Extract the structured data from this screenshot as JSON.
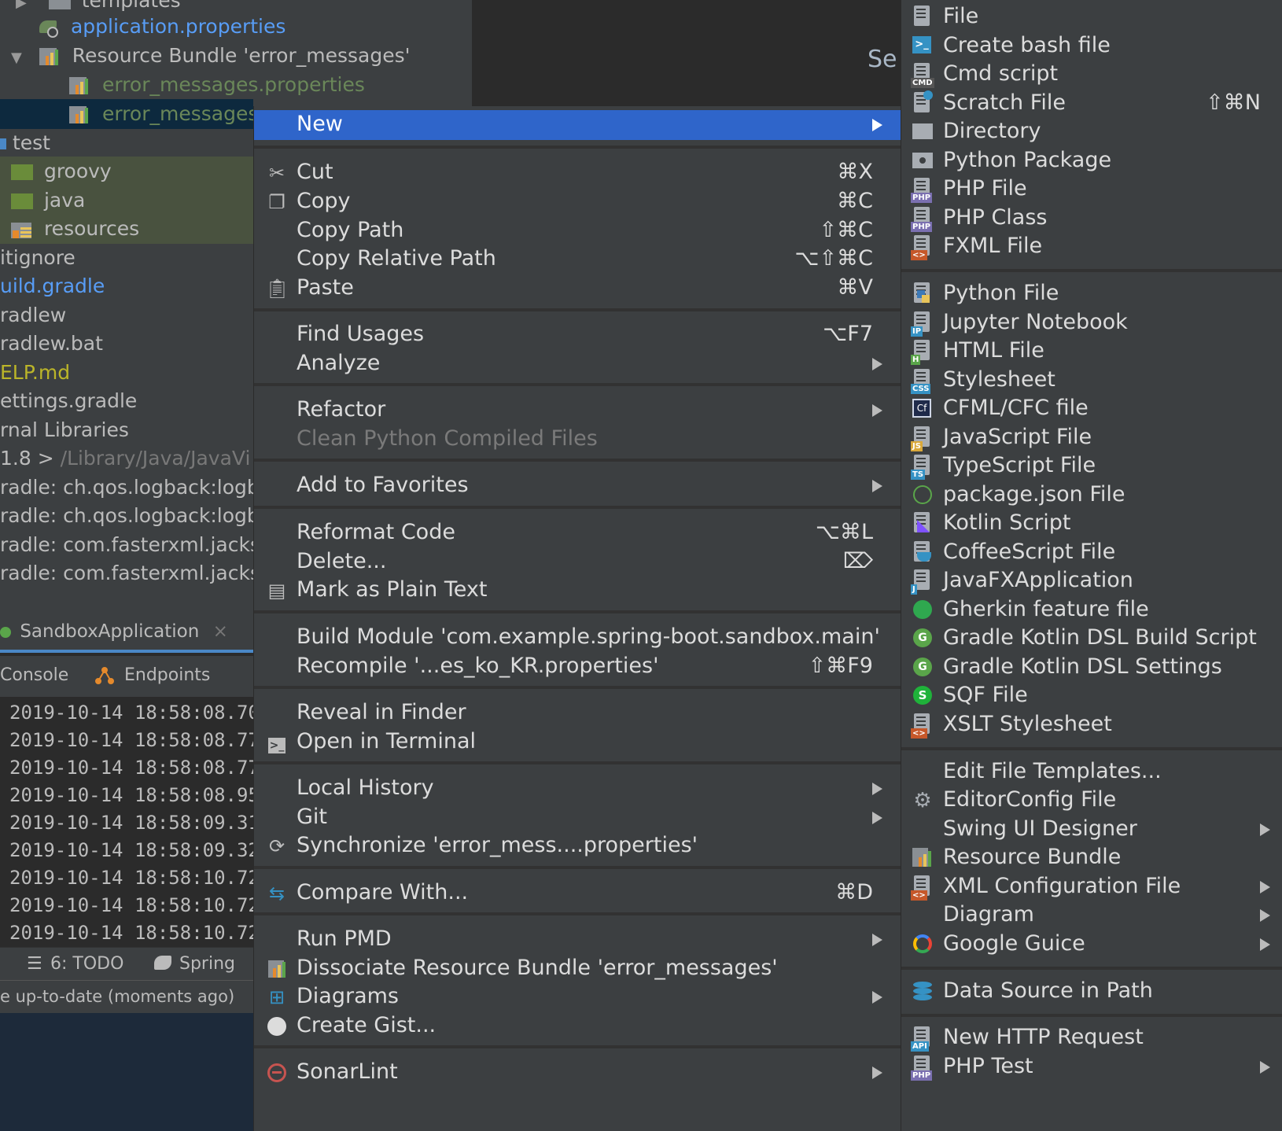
{
  "colors": {
    "menu_bg": "#3c3f41",
    "highlight": "#2f65ca",
    "green_path": "#6a8759",
    "link_blue": "#589df6",
    "yellow": "#bbb529"
  },
  "project_tree": {
    "rows": [
      {
        "label": "templates",
        "icon": "folder-icon"
      },
      {
        "label": "application.properties",
        "icon": "spring-properties-icon"
      },
      {
        "label": "Resource Bundle 'error_messages'",
        "icon": "resource-bundle-icon"
      },
      {
        "label": "error_messages.properties",
        "icon": "properties-file-icon"
      },
      {
        "label": "error_messages_",
        "icon": "properties-file-icon"
      },
      {
        "label": "test",
        "icon": "folder-icon"
      },
      {
        "label": "groovy",
        "icon": "folder-icon"
      },
      {
        "label": "java",
        "icon": "folder-icon"
      },
      {
        "label": "resources",
        "icon": "resources-folder-icon"
      },
      {
        "label": "itignore",
        "icon": ""
      },
      {
        "label": "uild.gradle",
        "icon": ""
      },
      {
        "label": "radlew",
        "icon": ""
      },
      {
        "label": "radlew.bat",
        "icon": ""
      },
      {
        "label": "ELP.md",
        "icon": ""
      },
      {
        "label": "ettings.gradle",
        "icon": ""
      },
      {
        "label": "rnal Libraries",
        "icon": ""
      },
      {
        "label": "1.8 >",
        "suffix": "/Library/Java/JavaVi",
        "icon": ""
      },
      {
        "label": "radle: ch.qos.logback:logb",
        "icon": ""
      },
      {
        "label": "radle: ch.qos.logback:logb",
        "icon": ""
      },
      {
        "label": "radle: com.fasterxml.jacks",
        "icon": ""
      },
      {
        "label": "radle: com.fasterxml.jacks",
        "icon": ""
      }
    ]
  },
  "editor": {
    "partial_text": "Se"
  },
  "run_tab": {
    "label": "SandboxApplication",
    "close": "×"
  },
  "console_tabs": {
    "console": "Console",
    "endpoints": "Endpoints"
  },
  "console_lines": [
    "2019-10-14 18:58:08.70",
    "2019-10-14 18:58:08.77",
    "2019-10-14 18:58:08.77",
    "2019-10-14 18:58:08.95",
    "2019-10-14 18:58:09.31",
    "2019-10-14 18:58:09.32",
    "2019-10-14 18:58:10.72",
    "2019-10-14 18:58:10.72",
    "2019-10-14 18:58:10.72"
  ],
  "bottom_bar": {
    "todo": "6: TODO",
    "spring": "Spring"
  },
  "status_bar": {
    "text": "e up-to-date (moments ago)"
  },
  "context_menu": {
    "new": "New",
    "cut": "Cut",
    "cut_key": "⌘X",
    "copy": "Copy",
    "copy_key": "⌘C",
    "copy_path": "Copy Path",
    "copy_path_key": "⇧⌘C",
    "copy_relative_path": "Copy Relative Path",
    "copy_relative_path_key": "⌥⇧⌘C",
    "paste": "Paste",
    "paste_key": "⌘V",
    "find_usages": "Find Usages",
    "find_usages_key": "⌥F7",
    "analyze": "Analyze",
    "refactor": "Refactor",
    "clean_python": "Clean Python Compiled Files",
    "add_favorites": "Add to Favorites",
    "reformat": "Reformat Code",
    "reformat_key": "⌥⌘L",
    "delete": "Delete...",
    "delete_key": "⌦",
    "mark_plain": "Mark as Plain Text",
    "build_module": "Build Module 'com.example.spring-boot.sandbox.main'",
    "recompile": "Recompile '...es_ko_KR.properties'",
    "recompile_key": "⇧⌘F9",
    "reveal_finder": "Reveal in Finder",
    "open_terminal": "Open in Terminal",
    "local_history": "Local History",
    "git": "Git",
    "synchronize": "Synchronize 'error_mess....properties'",
    "compare_with": "Compare With...",
    "compare_with_key": "⌘D",
    "run_pmd": "Run PMD",
    "dissociate": "Dissociate Resource Bundle 'error_messages'",
    "diagrams": "Diagrams",
    "create_gist": "Create Gist...",
    "sonarlint": "SonarLint"
  },
  "new_submenu": {
    "file": "File",
    "bash": "Create bash file",
    "cmd": "Cmd script",
    "scratch": "Scratch File",
    "scratch_key": "⇧⌘N",
    "directory": "Directory",
    "python_package": "Python Package",
    "php_file": "PHP File",
    "php_class": "PHP Class",
    "fxml": "FXML File",
    "python_file": "Python File",
    "jupyter": "Jupyter Notebook",
    "html": "HTML File",
    "stylesheet": "Stylesheet",
    "cfml": "CFML/CFC file",
    "javascript": "JavaScript File",
    "typescript": "TypeScript File",
    "package_json": "package.json File",
    "kotlin_script": "Kotlin Script",
    "coffeescript": "CoffeeScript File",
    "javafx": "JavaFXApplication",
    "gherkin": "Gherkin feature file",
    "gradle_kotlin_build": "Gradle Kotlin DSL Build Script",
    "gradle_kotlin_settings": "Gradle Kotlin DSL Settings",
    "sqf": "SQF File",
    "xslt": "XSLT Stylesheet",
    "edit_templates": "Edit File Templates...",
    "editorconfig": "EditorConfig File",
    "swing": "Swing UI Designer",
    "resource_bundle": "Resource Bundle",
    "xml_config": "XML Configuration File",
    "diagram": "Diagram",
    "google_guice": "Google Guice",
    "data_source": "Data Source in Path",
    "http_request": "New HTTP Request",
    "php_test": "PHP Test"
  },
  "icon_badges": {
    "cmd": "CMD",
    "php": "PHP",
    "ip": "IP",
    "h": "H",
    "css": "CSS",
    "cf": "Cf",
    "js": "JS",
    "ts": "TS",
    "j": "J",
    "api": "API",
    "g": "G",
    "s": "S",
    "xml": "<>"
  }
}
